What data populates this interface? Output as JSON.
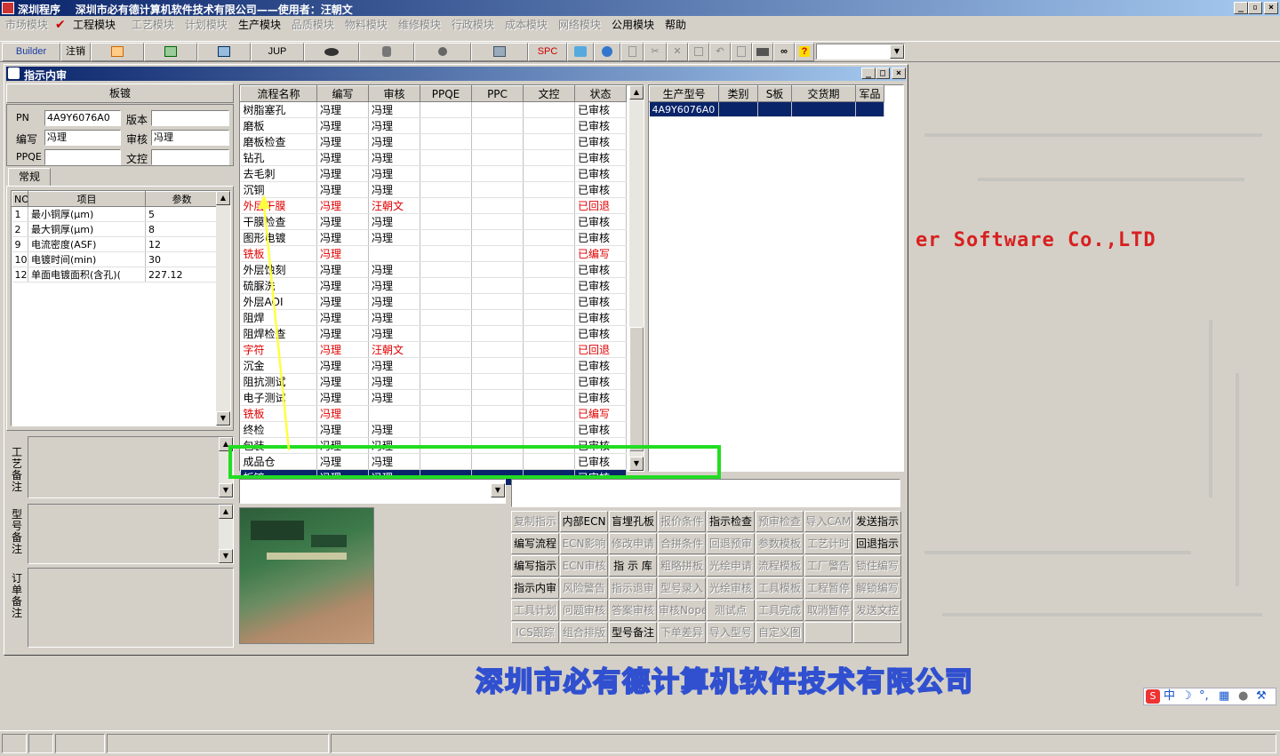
{
  "titlebar": {
    "text": "深圳程序    深圳市必有德计算机软件技术有限公司——使用者：汪朝文"
  },
  "menu": {
    "items": [
      {
        "label": "市场模块",
        "enabled": false
      },
      {
        "label": "工程模块",
        "enabled": true
      },
      {
        "label": "工艺模块",
        "enabled": false
      },
      {
        "label": "计划模块",
        "enabled": false
      },
      {
        "label": "生产模块",
        "enabled": true
      },
      {
        "label": "品质模块",
        "enabled": false
      },
      {
        "label": "物料模块",
        "enabled": false
      },
      {
        "label": "维修模块",
        "enabled": false
      },
      {
        "label": "行政模块",
        "enabled": false
      },
      {
        "label": "成本模块",
        "enabled": false
      },
      {
        "label": "网络模块",
        "enabled": false
      },
      {
        "label": "公用模块",
        "enabled": true
      },
      {
        "label": "帮助",
        "enabled": true
      }
    ]
  },
  "toolbar": {
    "builder": "Builder",
    "logout": "注销",
    "jup": "JUP",
    "spc": "SPC"
  },
  "background": {
    "software_text": "er Software Co.,LTD",
    "company_text": "深圳市必有德计算机软件技术有限公司"
  },
  "window": {
    "title": "指示内审",
    "board_header": "板镀",
    "fields": {
      "pn_label": "PN",
      "pn_value": "4A9Y6076A0",
      "version_label": "版本",
      "version_value": "",
      "author_label": "编写",
      "author_value": "冯理",
      "review_label": "审核",
      "review_value": "冯理",
      "ppqe_label": "PPQE",
      "ppqe_value": "",
      "dcc_label": "文控",
      "dcc_value": ""
    },
    "tab": "常规",
    "params": {
      "headers": [
        "NO",
        "项目",
        "参数"
      ],
      "rows": [
        [
          "1",
          "最小铜厚(μm)",
          "5"
        ],
        [
          "2",
          "最大铜厚(μm)",
          "8"
        ],
        [
          "9",
          "电流密度(ASF)",
          "12"
        ],
        [
          "10",
          "电镀时间(min)",
          "30"
        ],
        [
          "12",
          "单面电镀面积(含孔)(",
          "227.12"
        ]
      ]
    },
    "side_labels": {
      "process_note": "工艺备注",
      "model_note": "型号备注",
      "order_note": "订单备注"
    },
    "flow": {
      "headers": [
        "流程名称",
        "编写",
        "审核",
        "PPQE",
        "PPC",
        "文控",
        "状态"
      ],
      "rows": [
        {
          "cells": [
            "树脂塞孔",
            "冯理",
            "冯理",
            "",
            "",
            "",
            "已审核"
          ],
          "red": false
        },
        {
          "cells": [
            "磨板",
            "冯理",
            "冯理",
            "",
            "",
            "",
            "已审核"
          ],
          "red": false
        },
        {
          "cells": [
            "磨板检查",
            "冯理",
            "冯理",
            "",
            "",
            "",
            "已审核"
          ],
          "red": false
        },
        {
          "cells": [
            "钻孔",
            "冯理",
            "冯理",
            "",
            "",
            "",
            "已审核"
          ],
          "red": false
        },
        {
          "cells": [
            "去毛刺",
            "冯理",
            "冯理",
            "",
            "",
            "",
            "已审核"
          ],
          "red": false
        },
        {
          "cells": [
            "沉铜",
            "冯理",
            "冯理",
            "",
            "",
            "",
            "已审核"
          ],
          "red": false
        },
        {
          "cells": [
            "外层干膜",
            "冯理",
            "汪朝文",
            "",
            "",
            "",
            "已回退"
          ],
          "red": true
        },
        {
          "cells": [
            "干膜检查",
            "冯理",
            "冯理",
            "",
            "",
            "",
            "已审核"
          ],
          "red": false
        },
        {
          "cells": [
            "图形电镀",
            "冯理",
            "冯理",
            "",
            "",
            "",
            "已审核"
          ],
          "red": false
        },
        {
          "cells": [
            "铣板",
            "冯理",
            "",
            "",
            "",
            "",
            "已编写"
          ],
          "red": true
        },
        {
          "cells": [
            "外层蚀刻",
            "冯理",
            "冯理",
            "",
            "",
            "",
            "已审核"
          ],
          "red": false
        },
        {
          "cells": [
            "硫脲洗",
            "冯理",
            "冯理",
            "",
            "",
            "",
            "已审核"
          ],
          "red": false
        },
        {
          "cells": [
            "外层AOI",
            "冯理",
            "冯理",
            "",
            "",
            "",
            "已审核"
          ],
          "red": false
        },
        {
          "cells": [
            "阻焊",
            "冯理",
            "冯理",
            "",
            "",
            "",
            "已审核"
          ],
          "red": false
        },
        {
          "cells": [
            "阻焊检查",
            "冯理",
            "冯理",
            "",
            "",
            "",
            "已审核"
          ],
          "red": false
        },
        {
          "cells": [
            "字符",
            "冯理",
            "汪朝文",
            "",
            "",
            "",
            "已回退"
          ],
          "red": true
        },
        {
          "cells": [
            "沉金",
            "冯理",
            "冯理",
            "",
            "",
            "",
            "已审核"
          ],
          "red": false
        },
        {
          "cells": [
            "阻抗测试",
            "冯理",
            "冯理",
            "",
            "",
            "",
            "已审核"
          ],
          "red": false
        },
        {
          "cells": [
            "电子测试",
            "冯理",
            "冯理",
            "",
            "",
            "",
            "已审核"
          ],
          "red": false
        },
        {
          "cells": [
            "铣板",
            "冯理",
            "",
            "",
            "",
            "",
            "已编写"
          ],
          "red": true
        },
        {
          "cells": [
            "终检",
            "冯理",
            "冯理",
            "",
            "",
            "",
            "已审核"
          ],
          "red": false
        },
        {
          "cells": [
            "包装",
            "冯理",
            "冯理",
            "",
            "",
            "",
            "已审核"
          ],
          "red": false
        },
        {
          "cells": [
            "成品仓",
            "冯理",
            "冯理",
            "",
            "",
            "",
            "已审核"
          ],
          "red": false
        },
        {
          "cells": [
            "板镀",
            "冯理",
            "冯理",
            "",
            "",
            "",
            "已审核"
          ],
          "red": false,
          "selected": true
        }
      ]
    },
    "models": {
      "headers": [
        "生产型号",
        "类别",
        "S板",
        "交货期",
        "军品"
      ],
      "rows": [
        [
          "4A9Y6076A0",
          "",
          "",
          "",
          ""
        ]
      ]
    },
    "buttons": [
      [
        {
          "l": "复制指示",
          "e": false
        },
        {
          "l": "内部ECN",
          "e": true
        },
        {
          "l": "盲埋孔板",
          "e": true
        },
        {
          "l": "报价条件",
          "e": false
        },
        {
          "l": "指示检查",
          "e": true
        },
        {
          "l": "预审检查",
          "e": false
        },
        {
          "l": "导入CAM",
          "e": false
        },
        {
          "l": "发送指示",
          "e": true
        }
      ],
      [
        {
          "l": "编写流程",
          "e": true
        },
        {
          "l": "ECN影响",
          "e": false
        },
        {
          "l": "修改申请",
          "e": false
        },
        {
          "l": "合拼条件",
          "e": false
        },
        {
          "l": "回退预审",
          "e": false
        },
        {
          "l": "参数模板",
          "e": false
        },
        {
          "l": "工艺计时",
          "e": false
        },
        {
          "l": "回退指示",
          "e": true
        }
      ],
      [
        {
          "l": "编写指示",
          "e": true
        },
        {
          "l": "ECN审核",
          "e": false
        },
        {
          "l": "指 示 库",
          "e": true
        },
        {
          "l": "粗略拼板",
          "e": false
        },
        {
          "l": "光绘申请",
          "e": false
        },
        {
          "l": "流程模板",
          "e": false
        },
        {
          "l": "工厂警告",
          "e": false
        },
        {
          "l": "锁住编写",
          "e": false
        }
      ],
      [
        {
          "l": "指示内审",
          "e": true
        },
        {
          "l": "风险警告",
          "e": false
        },
        {
          "l": "指示退审",
          "e": false
        },
        {
          "l": "型号录入",
          "e": false
        },
        {
          "l": "光绘审核",
          "e": false
        },
        {
          "l": "工具模板",
          "e": false
        },
        {
          "l": "工程暂停",
          "e": false
        },
        {
          "l": "解锁编写",
          "e": false
        }
      ],
      [
        {
          "l": "工具计划",
          "e": false
        },
        {
          "l": "问题审核",
          "e": false
        },
        {
          "l": "答案审核",
          "e": false
        },
        {
          "l": "审核Nope",
          "e": false
        },
        {
          "l": "测试点",
          "e": false
        },
        {
          "l": "工具完成",
          "e": false
        },
        {
          "l": "取消暂停",
          "e": false
        },
        {
          "l": "发送文控",
          "e": false
        }
      ],
      [
        {
          "l": "ICS跟踪",
          "e": false
        },
        {
          "l": "组合排版",
          "e": false
        },
        {
          "l": "型号备注",
          "e": true
        },
        {
          "l": "下单差异",
          "e": false
        },
        {
          "l": "导入型号",
          "e": false
        },
        {
          "l": "自定义图",
          "e": false
        },
        {
          "l": "",
          "e": false
        },
        {
          "l": "",
          "e": false
        }
      ]
    ]
  },
  "ime": {
    "label": "中"
  },
  "colors": {
    "highlight_box": "#22dd22",
    "arrow": "#ffff40",
    "selection": "#0a246a",
    "red_text": "#e00000"
  }
}
